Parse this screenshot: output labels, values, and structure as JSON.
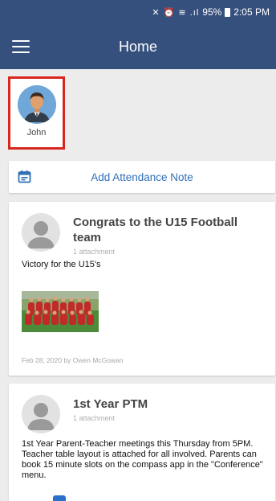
{
  "status_bar": {
    "icons": "✕ ⏰ ≋ .ıl",
    "battery": "95%",
    "time": "2:05 PM"
  },
  "app_bar": {
    "title": "Home",
    "menu_icon": "hamburger-menu-icon"
  },
  "student": {
    "name": "John"
  },
  "attendance": {
    "label": "Add Attendance Note",
    "icon": "calendar-icon",
    "accent": "#2f6fb8"
  },
  "posts": [
    {
      "title": "Congrats to the U15 Football team",
      "attachments": "1 attachment",
      "body": "Victory for the U15's",
      "meta": "Feb 28, 2020 by Owen McGowan"
    },
    {
      "title": "1st Year PTM",
      "attachments": "1 attachment",
      "body": "1st Year Parent-Teacher meetings this Thursday from 5PM. Teacher table layout is attached for all involved. Parents can book 15 minute slots on the compass app in the \"Conference\" menu."
    }
  ],
  "colors": {
    "primary": "#36507e",
    "highlight_border": "#d8261e",
    "background": "#ececec"
  }
}
